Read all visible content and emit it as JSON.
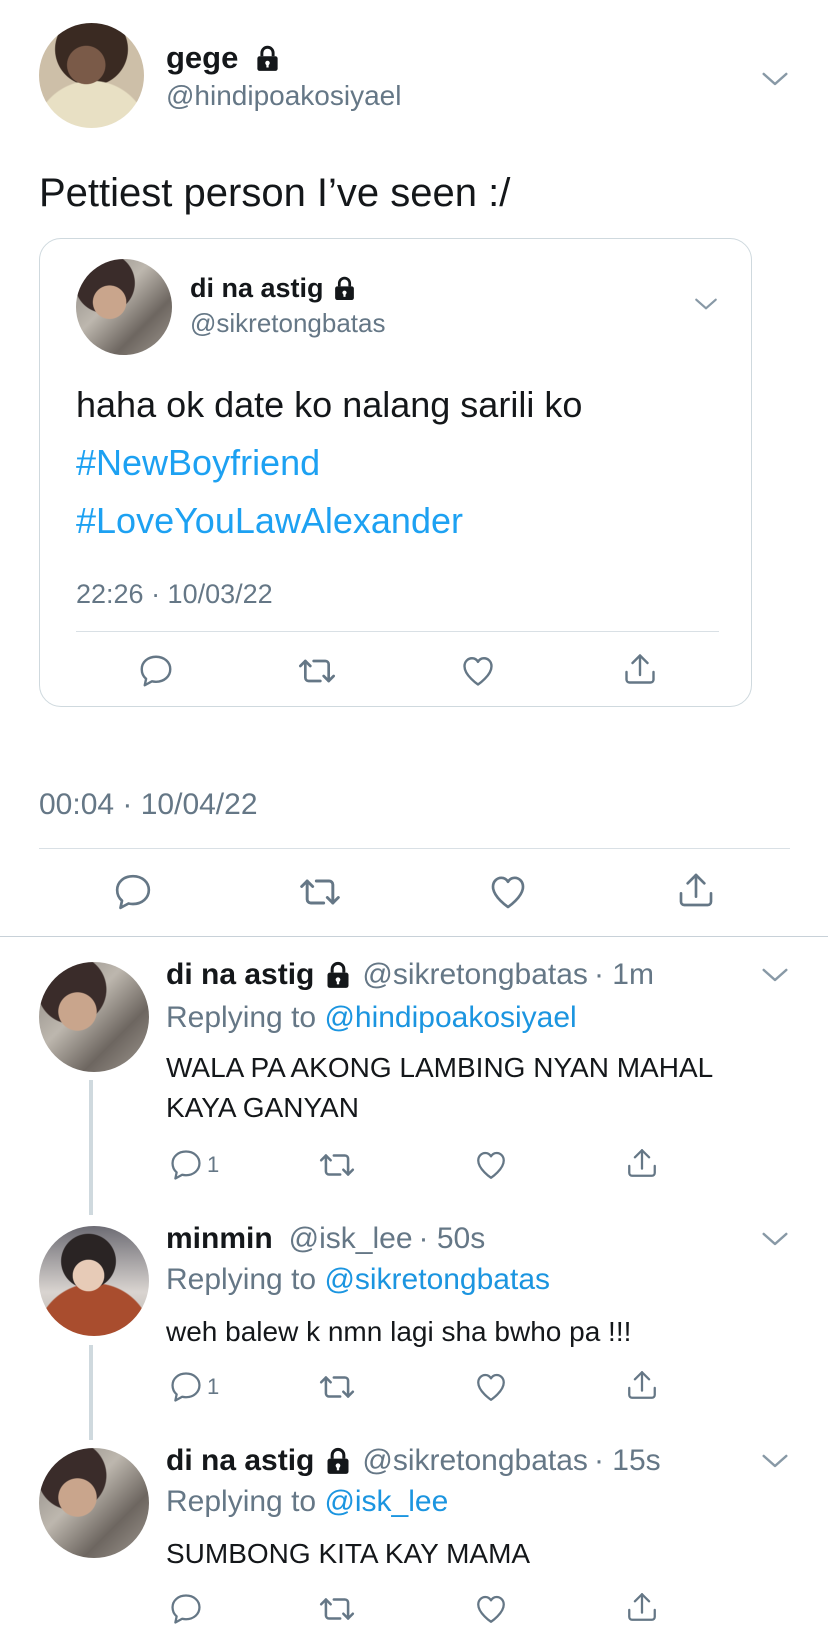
{
  "tweet": {
    "display_name": "gege",
    "handle": "@hindipoakosiyael",
    "text": "Pettiest person I’ve seen :/",
    "timestamp": "00:04 · 10/04/22"
  },
  "quoted": {
    "display_name": "di na astig",
    "handle": "@sikretongbatas",
    "text": "haha ok date ko nalang sarili ko",
    "hashtags": [
      "#NewBoyfriend",
      "#LoveYouLawAlexander"
    ],
    "timestamp": "22:26 · 10/03/22"
  },
  "replies": [
    {
      "display_name": "di na astig",
      "handle": "@sikretongbatas",
      "time": "· 1m",
      "replying_label": "Replying to",
      "replying_to": "@hindipoakosiyael",
      "text_line1": "WALA PA AKONG LAMBING NYAN MAHAL",
      "text_line2": "KAYA GANYAN",
      "reply_count": "1"
    },
    {
      "display_name": "minmin",
      "handle": "@isk_lee",
      "time": "· 50s",
      "replying_label": "Replying to",
      "replying_to": "@sikretongbatas",
      "text_line1": "weh balew k nmn lagi sha bwho pa !!!",
      "reply_count": "1"
    },
    {
      "display_name": "di na astig",
      "handle": "@sikretongbatas",
      "time": "· 15s",
      "replying_label": "Replying to",
      "replying_to": "@isk_lee",
      "text_line1": "SUMBONG KITA KAY MAMA",
      "reply_count": ""
    }
  ],
  "icons": {
    "lock": "lock-icon",
    "chevron": "chevron-down-icon",
    "reply": "reply-icon",
    "retweet": "retweet-icon",
    "like": "heart-icon",
    "share": "share-icon"
  },
  "colors": {
    "link": "#1b95e0",
    "secondary_text": "#657786",
    "divider": "#d9e0e5"
  }
}
